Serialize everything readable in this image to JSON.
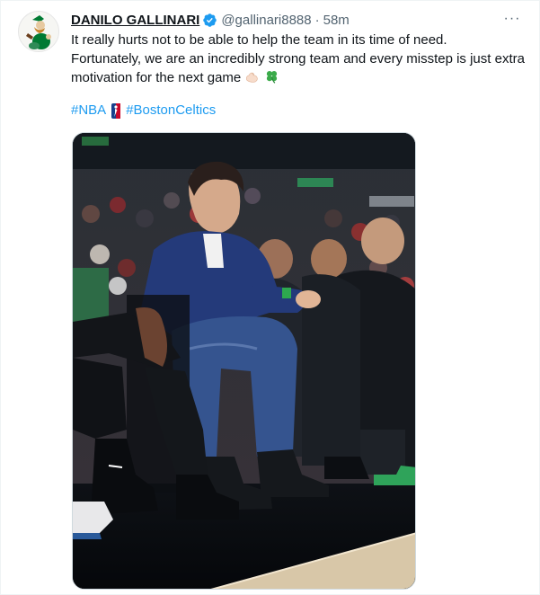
{
  "tweet": {
    "author_name": "DANILO GALLINARI",
    "handle": "@gallinari8888",
    "separator": "·",
    "time": "58m",
    "more_glyph": "···",
    "text_line1": "It really hurts not to be able to help the team in its time of need.",
    "text_line2": "Fortunately, we are an incredibly strong team and every misstep is just extra",
    "text_line3": "motivation for the next game",
    "hashtag_nba": "#NBA",
    "hashtag_celtics": "#BostonCeltics"
  },
  "icons": {
    "avatar": "celtics-leprechaun-logo",
    "verified": "verified-badge-icon",
    "more": "more-options-icon",
    "emoji_1": "flexed-biceps-emoji",
    "emoji_2": "four-leaf-clover-emoji",
    "nba": "nba-logo-icon"
  },
  "colors": {
    "accent": "#1d9bf0",
    "secondary_text": "#536471",
    "celtics_green": "#007a33"
  },
  "media": {
    "description_icon": "photo-courtside-players"
  }
}
